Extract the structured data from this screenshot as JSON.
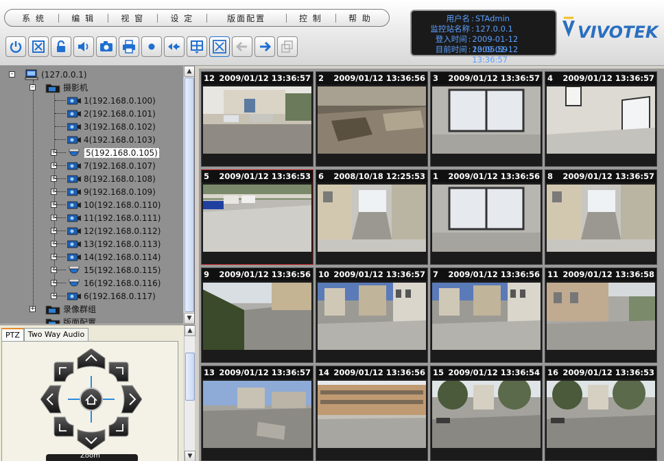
{
  "menu": [
    "系 统",
    "编 辑",
    "视 窗",
    "设 定",
    "版面配置",
    "控 制",
    "帮 助"
  ],
  "toolbar": [
    {
      "icon": "power-icon"
    },
    {
      "icon": "grid-layout-icon"
    },
    {
      "icon": "lock-icon"
    },
    {
      "icon": "speaker-icon"
    },
    {
      "icon": "camera-snapshot-icon"
    },
    {
      "icon": "printer-icon"
    },
    {
      "icon": "record-icon"
    },
    {
      "icon": "rewind-icon"
    },
    {
      "icon": "split-view-icon"
    },
    {
      "icon": "fullscreen-icon"
    },
    {
      "icon": "back-arrow-icon"
    },
    {
      "icon": "forward-arrow-icon"
    },
    {
      "icon": "copy-disabled-icon"
    }
  ],
  "info": {
    "user_label": "用户名",
    "user": "STAdmin",
    "station_label": "监控站名称",
    "station": "127.0.0.1",
    "login_label": "登入时间",
    "login": "2009-01-12 13:05:59",
    "now_label": "目前时间",
    "now": "2009-01-12 13:36:57"
  },
  "logo": {
    "text": "VIVOTEK",
    "color": "#2a6fc0"
  },
  "tree": {
    "root": "(127.0.0.1)",
    "group": "摄影机",
    "cameras": [
      "1(192.168.0.100)",
      "2(192.168.0.101)",
      "3(192.168.0.102)",
      "4(192.168.0.103)",
      "5(192.168.0.105)",
      "7(192.168.0.107)",
      "8(192.168.0.108)",
      "9(192.168.0.109)",
      "10(192.168.0.110)",
      "11(192.168.0.111)",
      "12(192.168.0.112)",
      "13(192.168.0.113)",
      "14(192.168.0.114)",
      "15(192.168.0.115)",
      "16(192.168.0.116)",
      "6(192.168.0.117)"
    ],
    "dome_indexes": [
      4,
      13,
      14
    ],
    "selected_index": 4,
    "recording_group": "录像群组",
    "layout_group": "版面配置"
  },
  "ptz": {
    "tabs": [
      "PTZ",
      "Two Way Audio"
    ],
    "zoom_label": "Zoom"
  },
  "cells": [
    {
      "id": "12",
      "time": "2009/01/12 13:36:57",
      "scene": "building-yard"
    },
    {
      "id": "2",
      "time": "2009/01/12 13:36:56",
      "scene": "construction"
    },
    {
      "id": "3",
      "time": "2009/01/12 13:36:57",
      "scene": "window-room"
    },
    {
      "id": "4",
      "time": "2009/01/12 13:36:57",
      "scene": "empty-room"
    },
    {
      "id": "5",
      "time": "2009/01/12 13:36:53",
      "scene": "parking",
      "active": true
    },
    {
      "id": "6",
      "time": "2008/10/18 12:25:53",
      "scene": "alley"
    },
    {
      "id": "1",
      "time": "2009/01/12 13:36:56",
      "scene": "window-room"
    },
    {
      "id": "8",
      "time": "2009/01/12 13:36:57",
      "scene": "alley"
    },
    {
      "id": "9",
      "time": "2009/01/12 13:36:56",
      "scene": "fence-road"
    },
    {
      "id": "10",
      "time": "2009/01/12 13:36:57",
      "scene": "street-buildings"
    },
    {
      "id": "7",
      "time": "2009/01/12 13:36:56",
      "scene": "street-buildings"
    },
    {
      "id": "11",
      "time": "2009/01/12 13:36:58",
      "scene": "wall-road"
    },
    {
      "id": "13",
      "time": "2009/01/12 13:36:57",
      "scene": "open-lot"
    },
    {
      "id": "14",
      "time": "2009/01/12 13:36:56",
      "scene": "factory"
    },
    {
      "id": "15",
      "time": "2009/01/12 13:36:54",
      "scene": "tree-street"
    },
    {
      "id": "16",
      "time": "2009/01/12 13:36:53",
      "scene": "tree-street"
    }
  ]
}
